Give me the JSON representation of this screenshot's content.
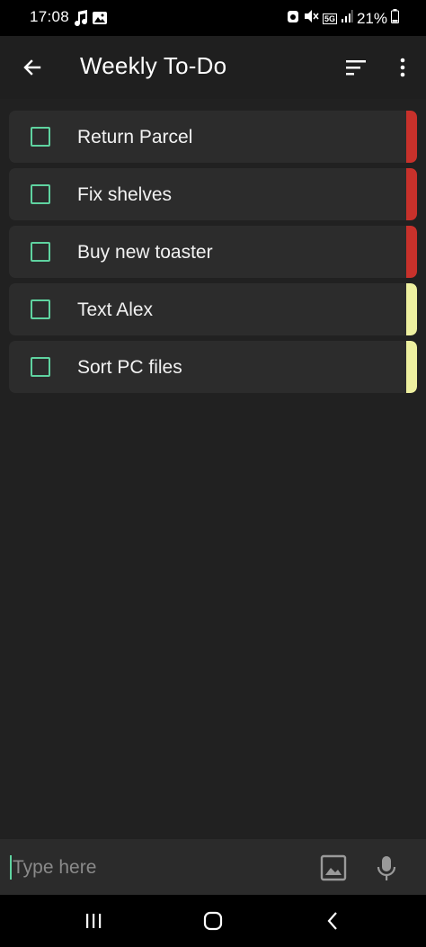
{
  "status_bar": {
    "time": "17:08",
    "battery": "21%",
    "network": "5G",
    "icons": [
      "music-note-icon",
      "image-icon",
      "alarm-icon",
      "mute-icon",
      "5g-icon",
      "signal-icon",
      "battery-icon"
    ]
  },
  "app_bar": {
    "title": "Weekly To-Do",
    "back_icon": "arrow-left-icon",
    "sort_icon": "sort-icon",
    "more_icon": "more-vert-icon"
  },
  "tasks": [
    {
      "label": "Return Parcel",
      "checked": false,
      "priority_color": "#c8312b"
    },
    {
      "label": "Fix shelves",
      "checked": false,
      "priority_color": "#c8312b"
    },
    {
      "label": "Buy new toaster",
      "checked": false,
      "priority_color": "#c8312b"
    },
    {
      "label": "Text Alex",
      "checked": false,
      "priority_color": "#eef0a0"
    },
    {
      "label": "Sort PC files",
      "checked": false,
      "priority_color": "#eef0a0"
    }
  ],
  "input_bar": {
    "placeholder": "Type here",
    "value": "",
    "image_icon": "image-icon",
    "mic_icon": "mic-icon"
  },
  "colors": {
    "accent": "#5fd3a0",
    "background": "#212121",
    "card": "#2c2c2c"
  },
  "nav_bar": {
    "icons": [
      "recents-icon",
      "home-icon",
      "back-icon"
    ]
  }
}
